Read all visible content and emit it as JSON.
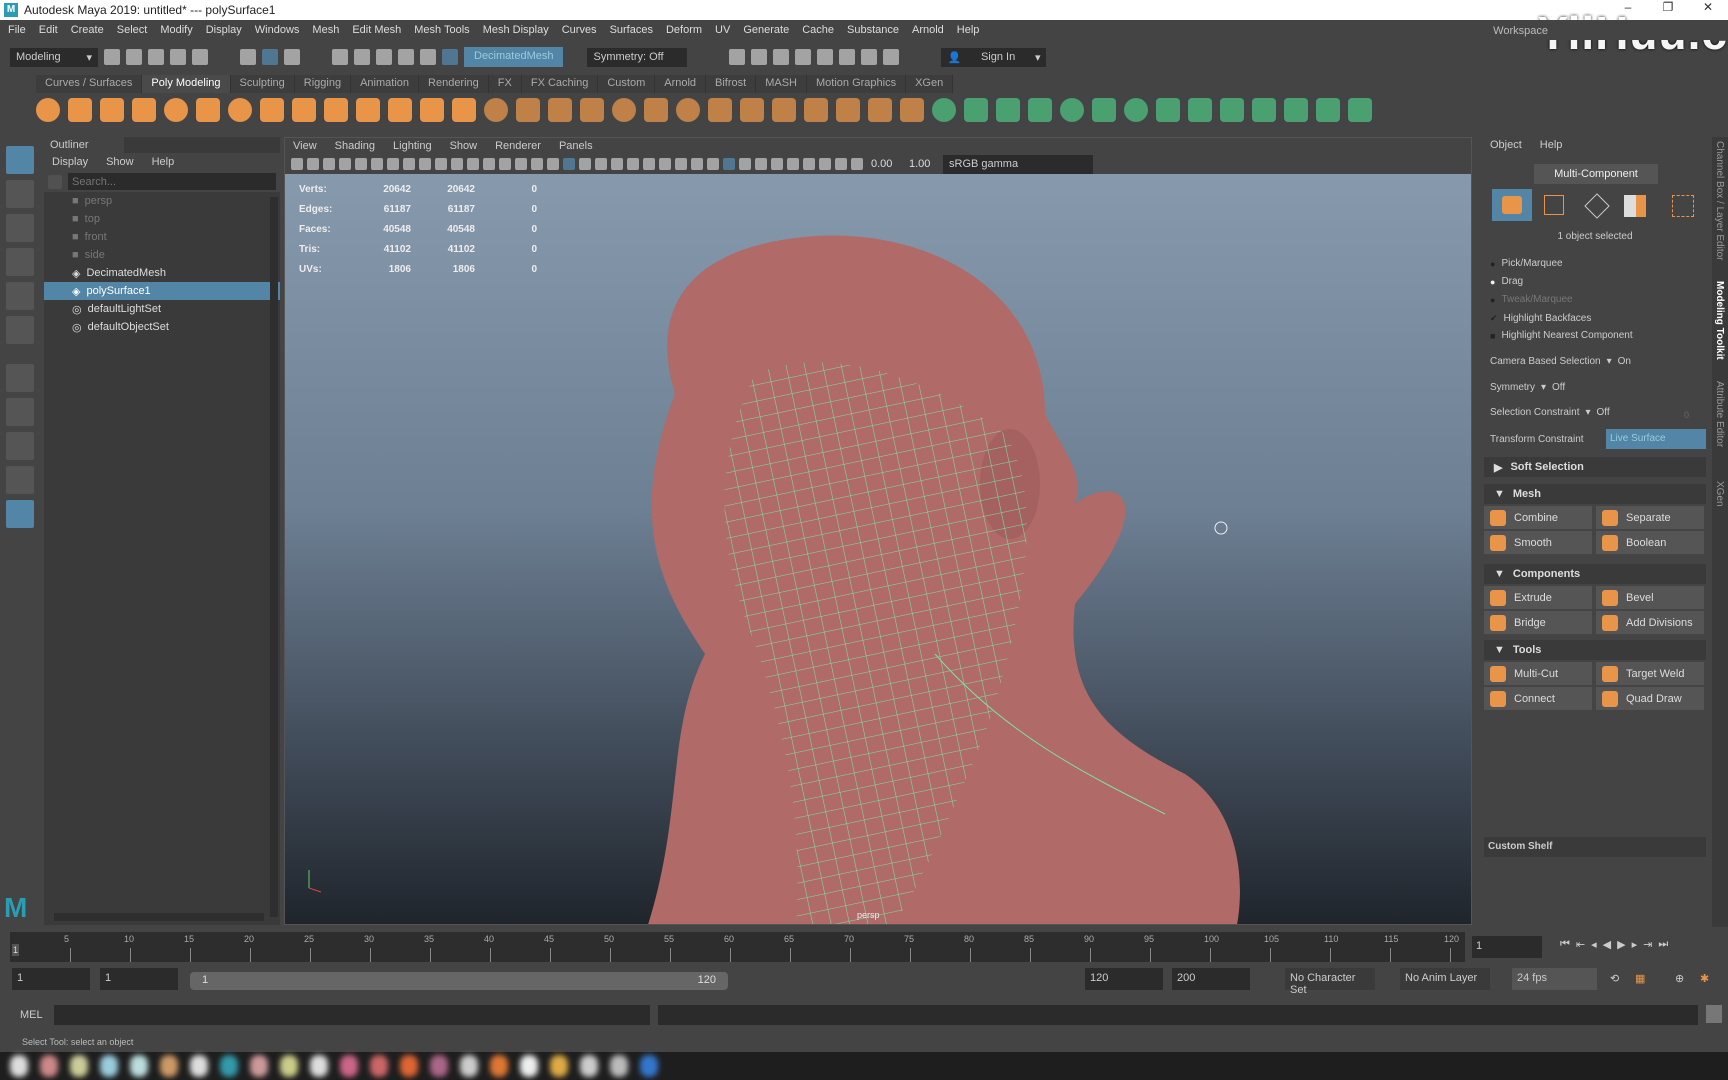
{
  "window": {
    "title": "Autodesk Maya 2019: untitled*  ---  polySurface1",
    "logo": "M",
    "watermark": "YiiHuu.c"
  },
  "menu": [
    "File",
    "Edit",
    "Create",
    "Select",
    "Modify",
    "Display",
    "Windows",
    "Mesh",
    "Edit Mesh",
    "Mesh Tools",
    "Mesh Display",
    "Curves",
    "Surfaces",
    "Deform",
    "UV",
    "Generate",
    "Cache",
    "Substance",
    "Arnold",
    "Help"
  ],
  "workspace_label": "Workspace",
  "statusline": {
    "mode": "Modeling",
    "object_field": "DecimatedMesh",
    "symmetry": "Symmetry: Off",
    "sign_in": "Sign In"
  },
  "shelf": {
    "tabs": [
      "Curves / Surfaces",
      "Poly Modeling",
      "Sculpting",
      "Rigging",
      "Animation",
      "Rendering",
      "FX",
      "FX Caching",
      "Custom",
      "Arnold",
      "Bifrost",
      "MASH",
      "Motion Graphics",
      "XGen"
    ],
    "active": "Poly Modeling",
    "icon_color": "#e8954a",
    "icons": [
      "sphere",
      "cube",
      "cylinder",
      "cone",
      "torus",
      "plane",
      "disc",
      "platonic",
      "super-shape",
      "type",
      "svg",
      "mirror",
      "bevel",
      "extrude"
    ]
  },
  "outliner": {
    "title": "Outliner",
    "menu": [
      "Display",
      "Show",
      "Help"
    ],
    "search_placeholder": "Search...",
    "items": [
      {
        "label": "persp",
        "icon": "camera-icon",
        "state": "dim"
      },
      {
        "label": "top",
        "icon": "camera-icon",
        "state": "dim"
      },
      {
        "label": "front",
        "icon": "camera-icon",
        "state": "dim"
      },
      {
        "label": "side",
        "icon": "camera-icon",
        "state": "dim"
      },
      {
        "label": "DecimatedMesh",
        "icon": "mesh-icon",
        "state": "normal"
      },
      {
        "label": "polySurface1",
        "icon": "mesh-icon",
        "state": "selected"
      },
      {
        "label": "defaultLightSet",
        "icon": "set-icon",
        "state": "normal"
      },
      {
        "label": "defaultObjectSet",
        "icon": "set-icon",
        "state": "normal"
      }
    ]
  },
  "viewport": {
    "menu": [
      "View",
      "Shading",
      "Lighting",
      "Show",
      "Renderer",
      "Panels"
    ],
    "exposure": "0.00",
    "gamma": "1.00",
    "color_space": "sRGB gamma",
    "camera": "persp",
    "hud": [
      {
        "label": "Verts:",
        "a": "20642",
        "b": "20642",
        "c": "0"
      },
      {
        "label": "Edges:",
        "a": "61187",
        "b": "61187",
        "c": "0"
      },
      {
        "label": "Faces:",
        "a": "40548",
        "b": "40548",
        "c": "0"
      },
      {
        "label": "Tris:",
        "a": "41102",
        "b": "41102",
        "c": "0"
      },
      {
        "label": "UVs:",
        "a": "1806",
        "b": "1806",
        "c": "0"
      }
    ],
    "mesh_color": "#b06a68",
    "wire_color": "#7fe0a0"
  },
  "toolkit": {
    "menu": [
      "Object",
      "Help"
    ],
    "mode": "Multi-Component",
    "selected": "1 object selected",
    "pick_marquee": "Pick/Marquee",
    "drag": "Drag",
    "tweak_marquee": "Tweak/Marquee",
    "highlight_backfaces": "Highlight Backfaces",
    "highlight_nearest": "Highlight Nearest Component",
    "camera_based_label": "Camera Based Selection",
    "camera_based_value": "On",
    "symmetry_label": "Symmetry",
    "symmetry_value": "Off",
    "sel_constraint_label": "Selection Constraint",
    "sel_constraint_value": "Off",
    "sel_constraint_num": "0",
    "transform_constraint_label": "Transform Constraint",
    "transform_constraint_value": "Live Surface",
    "soft_selection": "Soft Selection",
    "sections": [
      {
        "title": "Mesh",
        "buttons": [
          "Combine",
          "Separate",
          "Smooth",
          "Boolean"
        ]
      },
      {
        "title": "Components",
        "buttons": [
          "Extrude",
          "Bevel",
          "Bridge",
          "Add Divisions"
        ]
      },
      {
        "title": "Tools",
        "buttons": [
          "Multi-Cut",
          "Target Weld",
          "Connect",
          "Quad Draw"
        ]
      }
    ],
    "custom_shelf": "Custom Shelf"
  },
  "side_tabs": [
    "Channel Box / Layer Editor",
    "Modeling Toolkit",
    "Attribute Editor",
    "XGen"
  ],
  "timeline": {
    "ticks": [
      "5",
      "10",
      "15",
      "20",
      "25",
      "30",
      "35",
      "40",
      "45",
      "50",
      "55",
      "60",
      "65",
      "70",
      "75",
      "80",
      "85",
      "90",
      "95",
      "100",
      "105",
      "110",
      "115",
      "120"
    ],
    "current": "1",
    "current_field": "1"
  },
  "range": {
    "start": "1",
    "anim_start": "1",
    "slider_start": "1",
    "slider_end": "120",
    "end": "120",
    "anim_end": "200",
    "character_set": "No Character Set",
    "anim_layer": "No Anim Layer",
    "fps": "24 fps"
  },
  "mel": {
    "label": "MEL"
  },
  "help_line": "Select Tool: select an object"
}
